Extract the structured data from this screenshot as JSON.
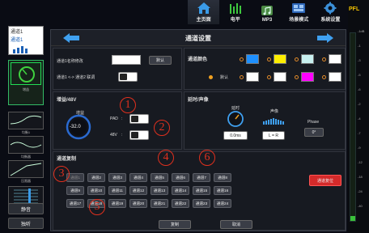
{
  "nav": {
    "items": [
      {
        "label": "主页面",
        "icon": "home-icon",
        "active": true
      },
      {
        "label": "电平",
        "icon": "level-meter-icon",
        "active": false
      },
      {
        "label": "MP3",
        "icon": "mp3-icon",
        "active": false
      },
      {
        "label": "场景模式",
        "icon": "scene-icon",
        "active": false
      },
      {
        "label": "系统设置",
        "icon": "gear-icon",
        "active": false
      }
    ]
  },
  "sidebar": {
    "channel_name": "通道1",
    "channel_name2": "通道1",
    "gain_label": "增益",
    "eq_labels": [
      "均衡1",
      "均衡器",
      "压限器"
    ],
    "bottom_label": "推子",
    "mute_button": "静音",
    "solo_button": "独听"
  },
  "header": {
    "title": "通道设置"
  },
  "name_section": {
    "rename_label": "通道1名称修改",
    "default_button": "默认",
    "link_label": "通道1 <-> 通道2 联调"
  },
  "color_section": {
    "title": "通道颜色",
    "default_label": "默认",
    "colors_row1": [
      "#1e90ff",
      "#ffee00",
      "#c8f0f0",
      "#ffffff"
    ],
    "colors_row2": [
      "#ffffff",
      "#ffffff",
      "#ff00ff",
      "#ffffff"
    ]
  },
  "gain_section": {
    "title": "增益/48V",
    "gain_label": "增益",
    "gain_value": "-32.0",
    "pad_label": "PAD",
    "v48_label": "48V"
  },
  "delay_section": {
    "title": "延时/声像",
    "delay_label": "延时",
    "delay_value": "0.0ms",
    "pan_label": "声像",
    "pan_value": "L = R",
    "phase_label": "Phase",
    "phase_value": "0°"
  },
  "copy_section": {
    "title": "通道复制",
    "channels": [
      "通道1",
      "通道2",
      "通道3",
      "通道4",
      "通道5",
      "通道6",
      "通道7",
      "通道8",
      "通道9",
      "通道10",
      "通道11",
      "通道12",
      "通道13",
      "通道14",
      "通道15",
      "通道16",
      "通道17",
      "通道18",
      "通道19",
      "通道20",
      "通道21",
      "通道22",
      "通道23",
      "通道24"
    ],
    "copy_button": "复制",
    "cancel_button": "取消",
    "reset_button": "通道复位"
  },
  "annotations": [
    "1",
    "2",
    "3",
    "4",
    "5",
    "6"
  ],
  "meter": {
    "title": "PFL",
    "ticks": [
      "-1dB",
      "-1",
      "-3",
      "-5",
      "-6",
      "-2",
      "-4",
      "-7",
      "-9",
      "-12",
      "-18",
      "-24",
      "-40"
    ]
  },
  "colors": {
    "accent": "#1e90ff",
    "annotation": "#e0301e",
    "reset_button": "#d42a2a"
  }
}
